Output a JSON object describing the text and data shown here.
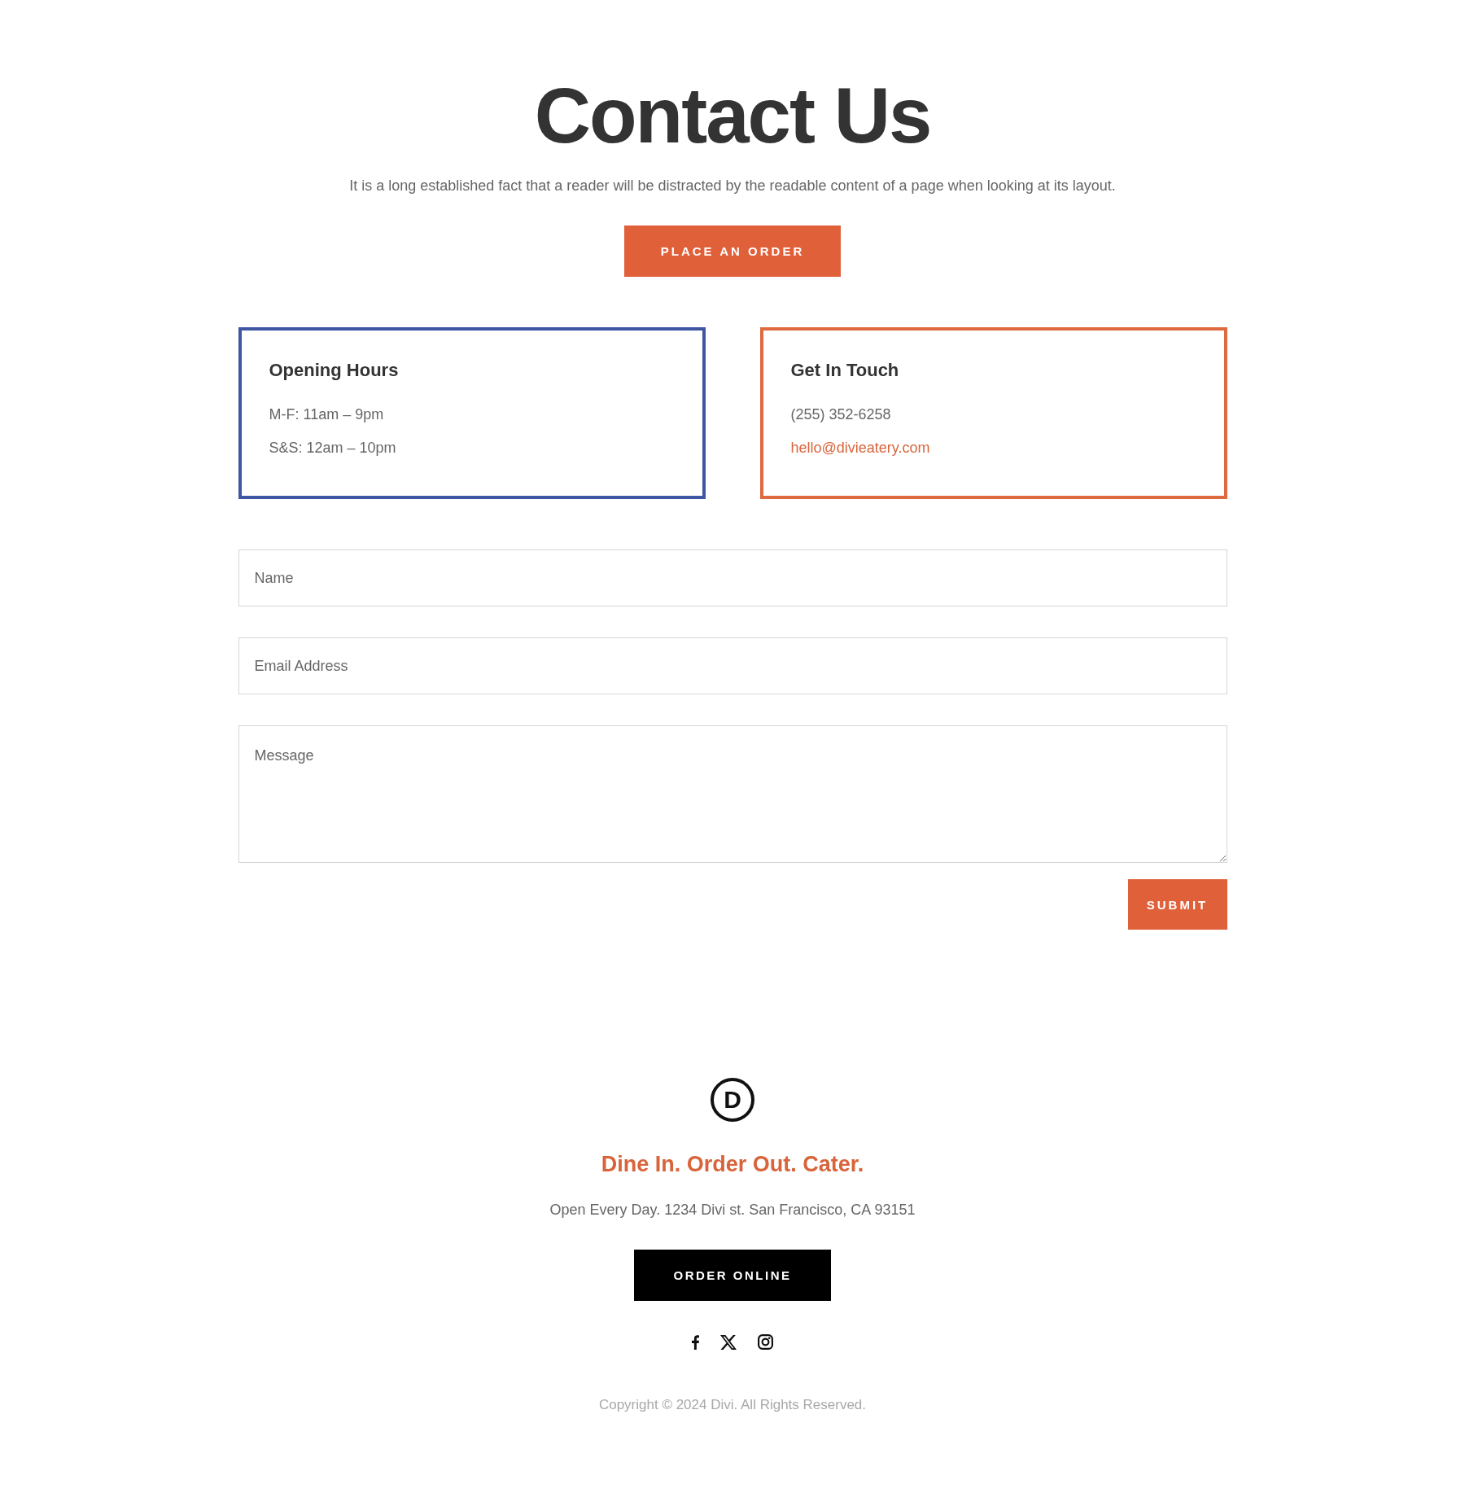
{
  "header": {
    "title": "Contact Us",
    "subtitle": "It is a long established fact that a reader will be distracted by the readable content of a page when looking at its layout.",
    "button": "PLACE AN ORDER"
  },
  "cards": [
    {
      "title": "Opening Hours",
      "color": "#3f56a3",
      "lines": [
        {
          "kind": "text",
          "text": "M-F: 11am – 9pm"
        },
        {
          "kind": "text",
          "text": "S&S: 12am – 10pm"
        }
      ]
    },
    {
      "title": "Get In Touch",
      "color": "#df6a40",
      "lines": [
        {
          "kind": "text",
          "text": "(255) 352-6258"
        },
        {
          "kind": "link",
          "text": "hello@divieatery.com"
        }
      ]
    }
  ],
  "form": {
    "fields": [
      {
        "kind": "input",
        "placeholder": "Name"
      },
      {
        "kind": "input",
        "placeholder": "Email Address"
      },
      {
        "kind": "textarea",
        "placeholder": "Message"
      }
    ],
    "submit": "SUBMIT"
  },
  "footer": {
    "logo": "D",
    "tagline": "Dine In. Order Out. Cater.",
    "address": "Open Every Day. 1234 Divi st. San Francisco, CA 93151",
    "button": "ORDER ONLINE",
    "social_links": [
      {
        "kind": "facebook"
      },
      {
        "kind": "x"
      },
      {
        "kind": "instagram"
      }
    ],
    "copyright": "Copyright © 2024 Divi. All Rights Reserved."
  }
}
